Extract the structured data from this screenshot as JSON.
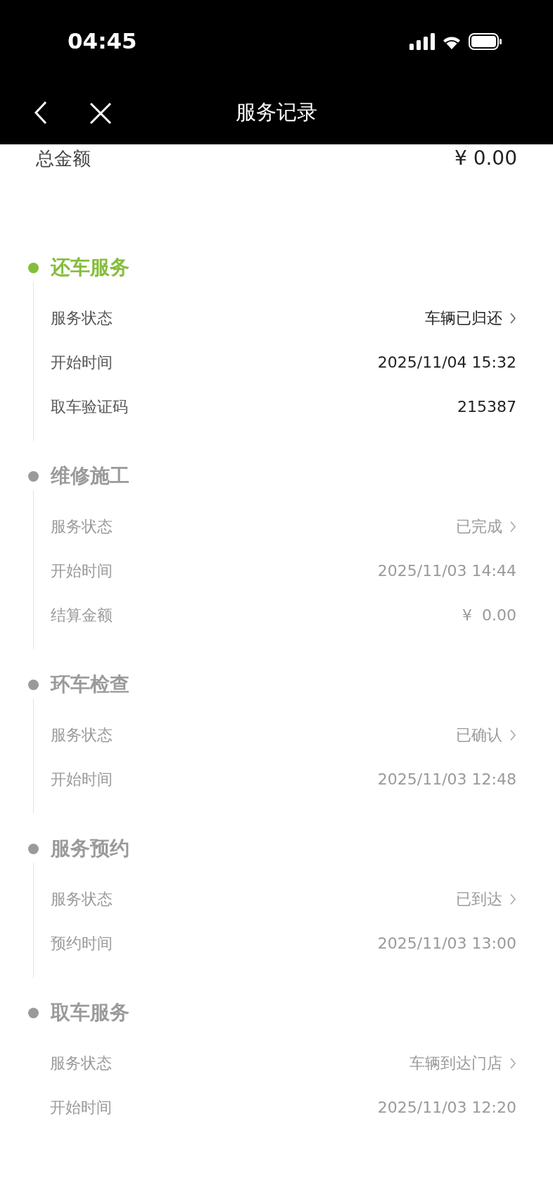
{
  "status_bar": {
    "time": "04:45"
  },
  "nav": {
    "title": "服务记录"
  },
  "total": {
    "label": "总金额",
    "value": "¥ 0.00"
  },
  "sections": [
    {
      "title": "还车服务",
      "active": true,
      "rows": [
        {
          "label": "服务状态",
          "value": "车辆已归还",
          "kind": "link"
        },
        {
          "label": "开始时间",
          "value": "2025/11/04 15:32",
          "kind": "plain"
        },
        {
          "label": "取车验证码",
          "value": "215387",
          "kind": "plain"
        }
      ]
    },
    {
      "title": "维修施工",
      "active": false,
      "rows": [
        {
          "label": "服务状态",
          "value": "已完成",
          "kind": "link"
        },
        {
          "label": "开始时间",
          "value": "2025/11/03 14:44",
          "kind": "plain"
        },
        {
          "label": "结算金额",
          "value": "¥  0.00",
          "kind": "plain"
        }
      ]
    },
    {
      "title": "环车检查",
      "active": false,
      "rows": [
        {
          "label": "服务状态",
          "value": "已确认",
          "kind": "link"
        },
        {
          "label": "开始时间",
          "value": "2025/11/03 12:48",
          "kind": "plain"
        }
      ]
    },
    {
      "title": "服务预约",
      "active": false,
      "rows": [
        {
          "label": "服务状态",
          "value": "已到达",
          "kind": "link"
        },
        {
          "label": "预约时间",
          "value": "2025/11/03 13:00",
          "kind": "plain"
        }
      ]
    },
    {
      "title": "取车服务",
      "active": false,
      "rows": [
        {
          "label": "服务状态",
          "value": "车辆到达门店",
          "kind": "link"
        },
        {
          "label": "开始时间",
          "value": "2025/11/03 12:20",
          "kind": "plain"
        }
      ]
    }
  ]
}
